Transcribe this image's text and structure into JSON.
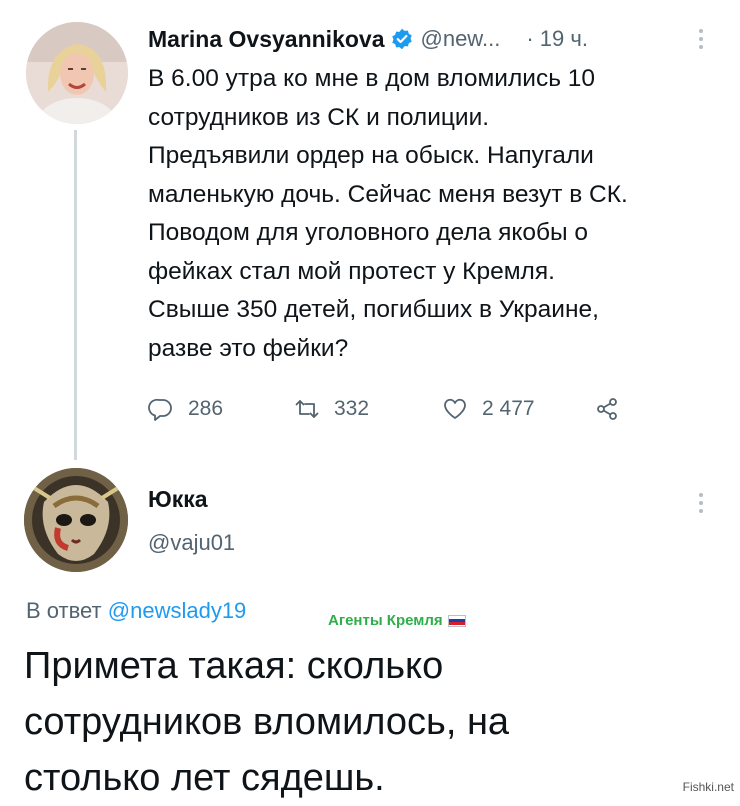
{
  "tweet": {
    "author_name": "Marina Ovsyannikova",
    "handle": "@new...",
    "separator": "·",
    "time": "19 ч.",
    "text_lines": [
      "В 6.00 утра ко мне в дом вломились 10",
      "сотрудников из СК и полиции.",
      "Предъявили ордер на обыск. Напугали",
      "маленькую дочь. Сейчас меня везут в СК.",
      "Поводом для уголовного дела якобы о",
      "фейках стал мой протест у Кремля.",
      "Свыше 350 детей, погибших в Украине,",
      "разве это фейки?"
    ],
    "replies": "286",
    "retweets": "332",
    "likes": "2 477",
    "icons": {
      "verified": "verified-badge-icon",
      "more": "more-vertical-icon",
      "reply": "reply-bubble-icon",
      "retweet": "retweet-icon",
      "like": "heart-icon",
      "share": "share-icon"
    },
    "verified_color": "#1d9bf0"
  },
  "reply": {
    "author_name": "Юкка",
    "handle": "@vaju01",
    "reply_prefix": "В ответ",
    "reply_to": "@newslady19",
    "text_lines": [
      "Примета такая: сколько",
      "сотрудников вломилось, на",
      "столько лет сядешь."
    ]
  },
  "stamp": {
    "text": "Агенты Кремля",
    "color": "#2fae4a",
    "flag_colors": [
      "#ffffff",
      "#1c3fae",
      "#d5202a"
    ]
  },
  "watermark": "Fishki.net",
  "colors": {
    "text": "#0f1419",
    "secondary": "#536471",
    "link": "#1d9bf0"
  }
}
